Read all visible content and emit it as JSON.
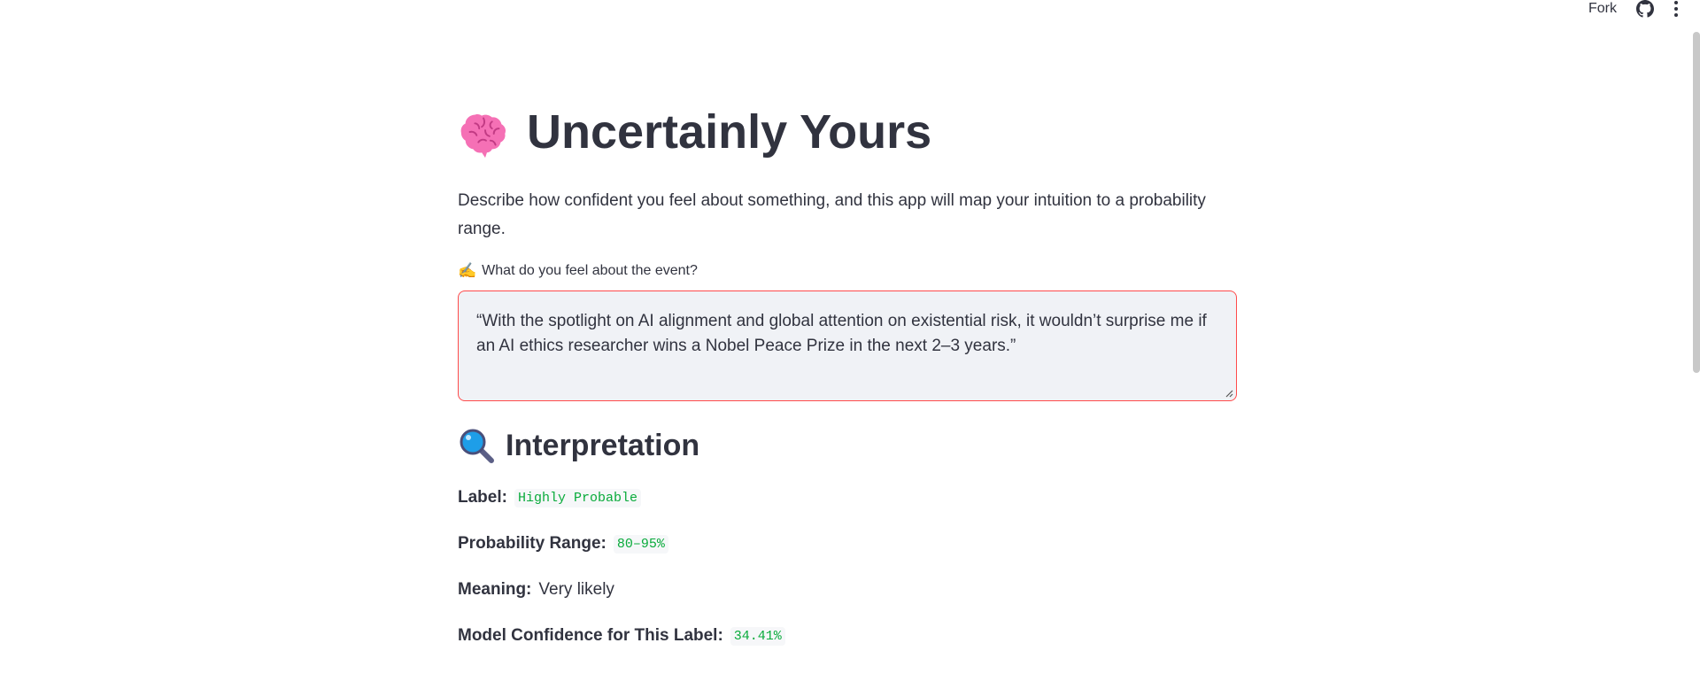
{
  "toolbar": {
    "fork_label": "Fork",
    "icons": [
      "github-icon",
      "more-vertical-icon"
    ]
  },
  "header": {
    "title": "Uncertainly Yours",
    "icon": "brain-icon"
  },
  "description": "Describe how confident you feel about something, and this app will map your intuition to a probability range.",
  "input": {
    "label_icon": "✍️",
    "label": "What do you feel about the event?",
    "value": "“With the spotlight on AI alignment and global attention on existential risk, it wouldn’t surprise me if an AI ethics researcher wins a Nobel Peace Prize in the next 2–3 years.”",
    "border_color": "#ff4b4b"
  },
  "interpretation": {
    "heading": "Interpretation",
    "icon": "magnifier-icon",
    "label_key": "Label:",
    "label_value": "Highly Probable",
    "prob_key": "Probability Range:",
    "prob_value": "80–95%",
    "meaning_key": "Meaning:",
    "meaning_value": "Very likely",
    "confidence_key": "Model Confidence for This Label:",
    "confidence_value": "34.41%",
    "value_color": "#09ab3b"
  }
}
